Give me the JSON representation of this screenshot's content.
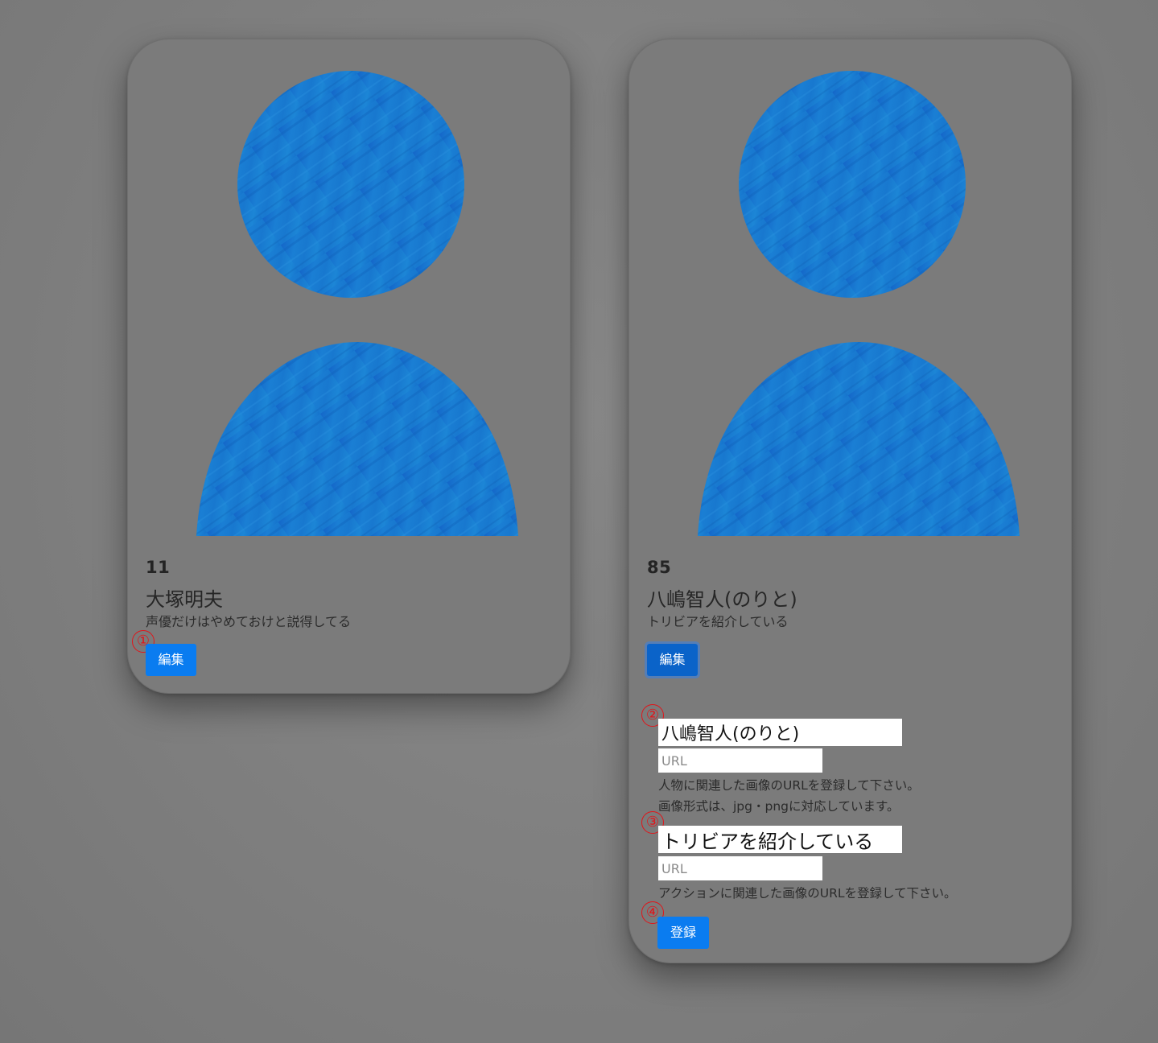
{
  "cards": [
    {
      "id": "11",
      "name": "大塚明夫",
      "description": "声優だけはやめておけと説得してる",
      "edit_label": "編集",
      "marker": "①"
    },
    {
      "id": "85",
      "name": "八嶋智人(のりと)",
      "description": "トリビアを紹介している",
      "edit_label": "編集",
      "edit_form": {
        "name_marker": "②",
        "name_value": "八嶋智人(のりと)",
        "person_image_placeholder": "URL",
        "person_image_help_1": "人物に関連した画像のURLを登録して下さい。",
        "person_image_help_2": "画像形式は、jpg・pngに対応しています。",
        "action_marker": "③",
        "action_value": "トリビアを紹介している",
        "action_image_placeholder": "URL",
        "action_image_help": "アクションに関連した画像のURLを登録して下さい。",
        "submit_marker": "④",
        "submit_label": "登録"
      }
    }
  ],
  "colors": {
    "background": "#7b7b7b",
    "card": "#7b7b7b",
    "primary_button": "#0a7cf0",
    "avatar_blue": "#1a7fd4",
    "marker_red": "#e0151a"
  },
  "icons": {
    "avatar": "user-silhouette-icon"
  }
}
